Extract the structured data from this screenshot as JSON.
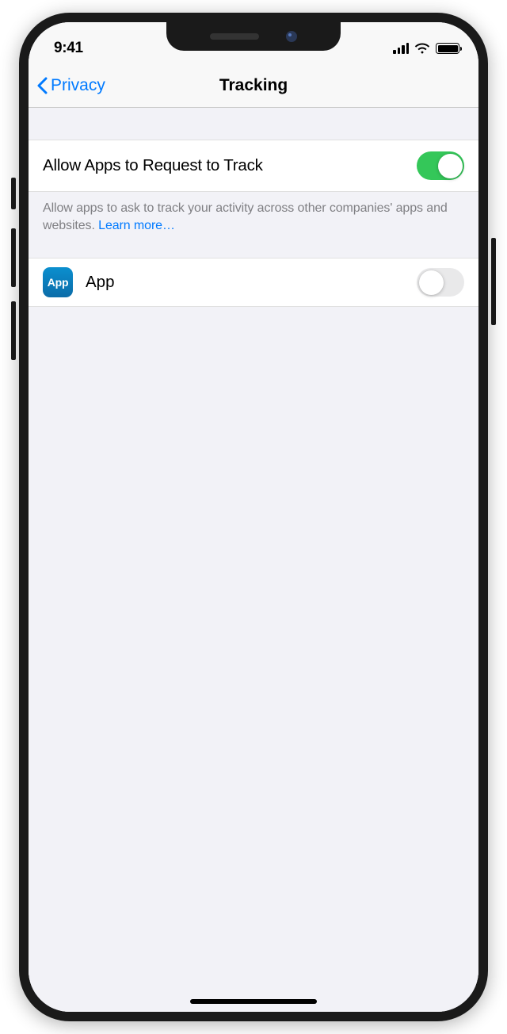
{
  "status": {
    "time": "9:41"
  },
  "nav": {
    "back_label": "Privacy",
    "title": "Tracking"
  },
  "settings": {
    "allow_tracking": {
      "label": "Allow Apps to Request to Track",
      "footer_text": "Allow apps to ask to track your activity across other companies' apps and websites. ",
      "learn_more": "Learn more…",
      "on": true
    }
  },
  "apps": [
    {
      "icon_label": "App",
      "name": "App",
      "on": false
    }
  ]
}
